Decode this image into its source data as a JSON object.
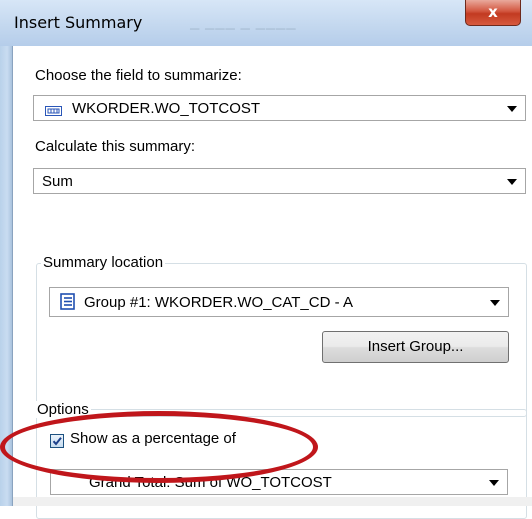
{
  "window": {
    "title": "Insert Summary",
    "close_label": "x",
    "colors": {
      "highlight_ring": "#c0161b",
      "title_bar": "#c4d8ef"
    }
  },
  "field": {
    "label": "Choose the field to summarize:",
    "value": "WKORDER.WO_TOTCOST",
    "icon": "field-icon"
  },
  "summary": {
    "label": "Calculate this summary:",
    "value": "Sum"
  },
  "location": {
    "group_label": "Summary location",
    "value": "Group #1: WKORDER.WO_CAT_CD - A",
    "icon": "group-icon",
    "insert_group_button": "Insert Group..."
  },
  "options": {
    "group_label": "Options",
    "show_percentage_label": "Show as a percentage of",
    "show_percentage_checked": true,
    "percentage_value": "Grand Total: Sum of WO_TOTCOST"
  }
}
